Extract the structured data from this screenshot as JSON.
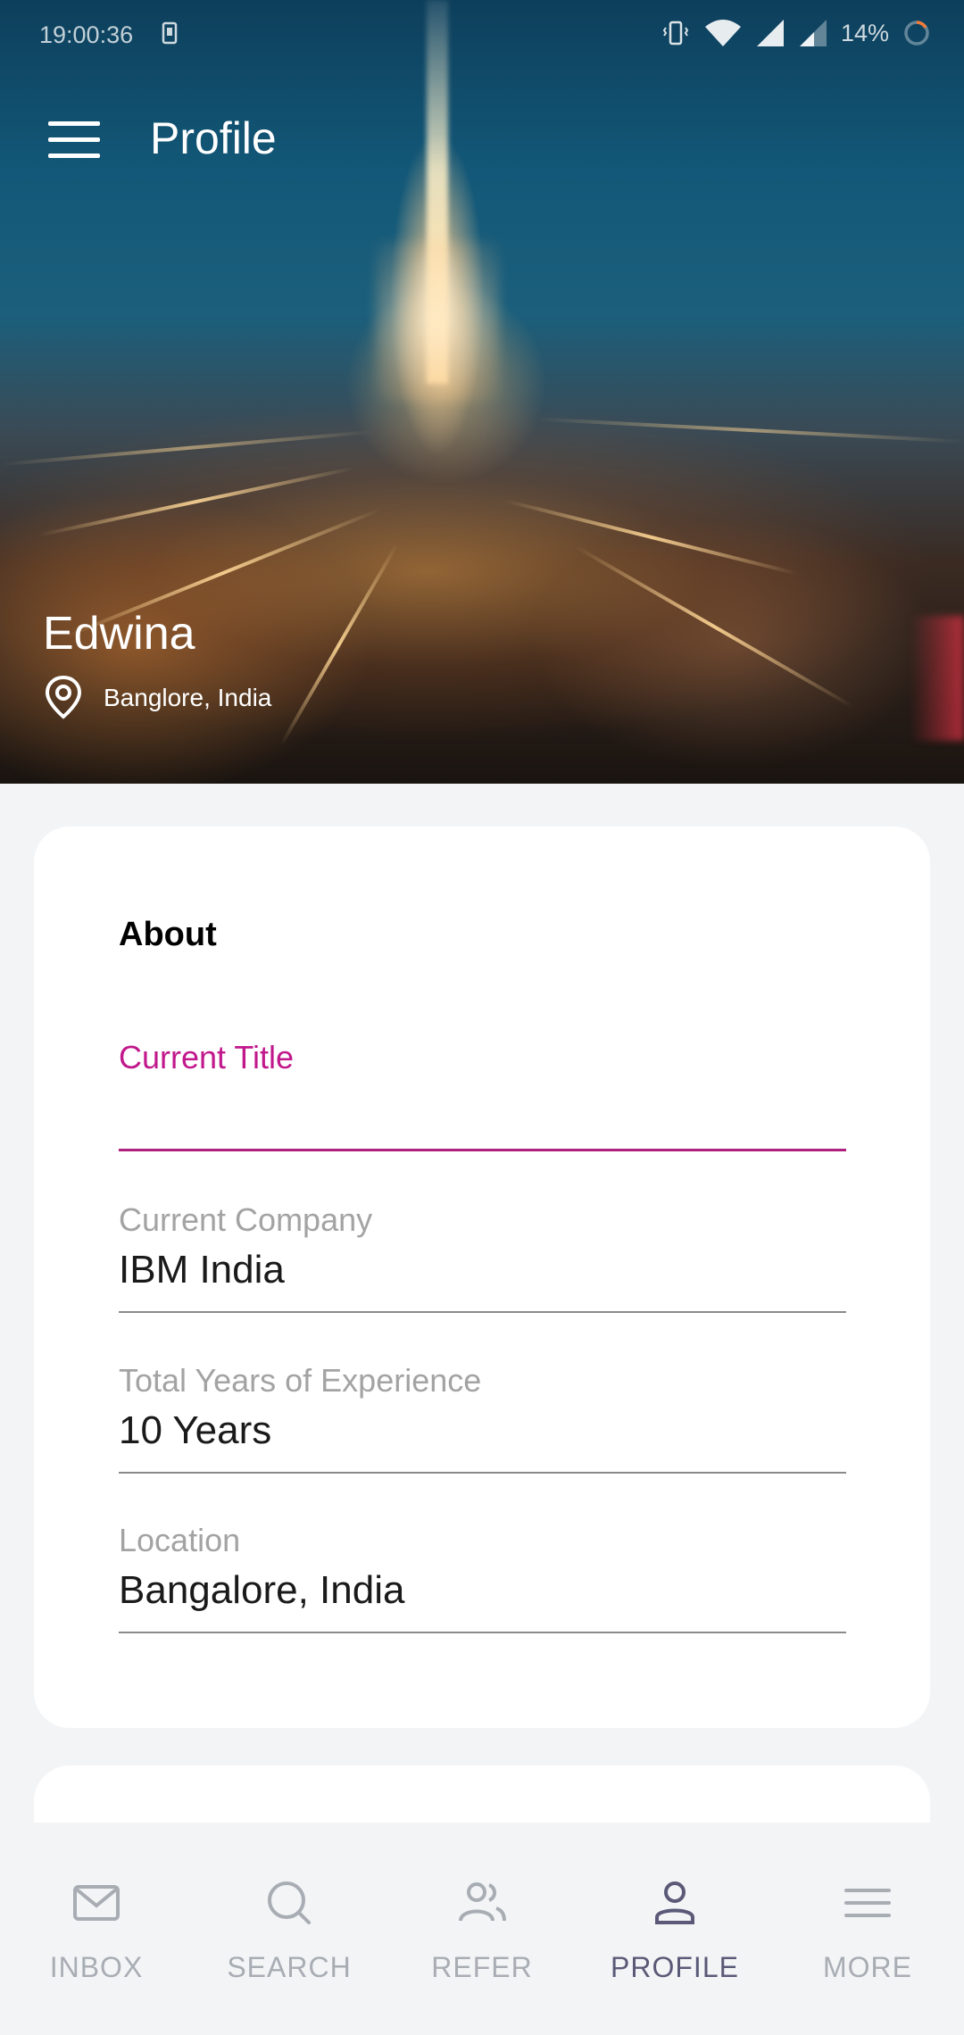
{
  "status_bar": {
    "time": "19:00:36",
    "battery": "14%"
  },
  "toolbar": {
    "title": "Profile",
    "menu_icon": "hamburger-menu-icon"
  },
  "profile": {
    "name": "Edwina",
    "location": "Banglore, India",
    "location_icon": "map-pin-icon"
  },
  "about": {
    "heading": "About",
    "fields": [
      {
        "label": "Current Title",
        "value": "",
        "active": true
      },
      {
        "label": "Current Company",
        "value": "IBM India",
        "active": false
      },
      {
        "label": "Total Years of Experience",
        "value": "10 Years",
        "active": false
      },
      {
        "label": "Location",
        "value": "Bangalore, India",
        "active": false
      }
    ]
  },
  "bottom_nav": {
    "items": [
      {
        "label": "INBOX",
        "icon": "mail-icon",
        "active": false
      },
      {
        "label": "SEARCH",
        "icon": "search-icon",
        "active": false
      },
      {
        "label": "REFER",
        "icon": "users-icon",
        "active": false
      },
      {
        "label": "PROFILE",
        "icon": "user-icon",
        "active": true
      },
      {
        "label": "MORE",
        "icon": "more-menu-icon",
        "active": false
      }
    ]
  },
  "colors": {
    "accent": "#c1188c",
    "active_nav": "#5a5a78",
    "inactive_nav": "#a8adb4",
    "page_bg": "#f3f4f6"
  }
}
